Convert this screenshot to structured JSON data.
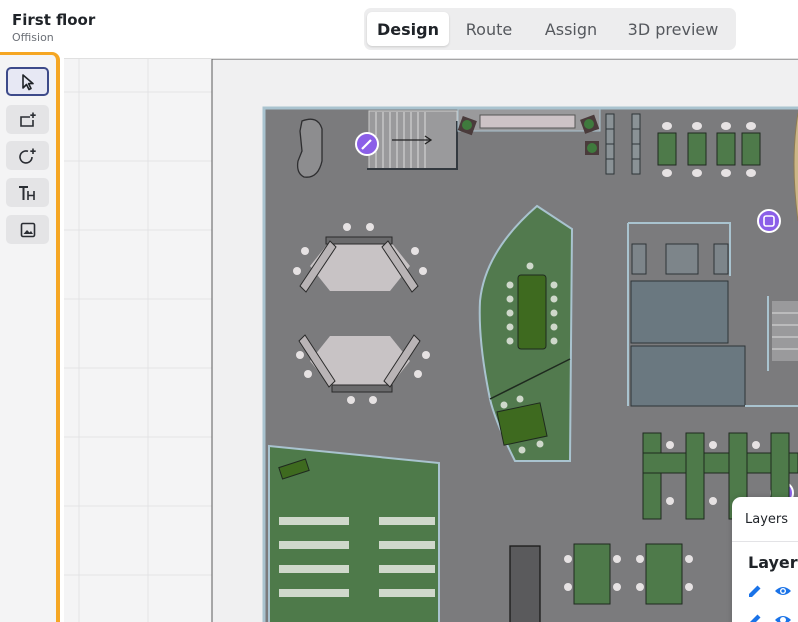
{
  "header": {
    "title": "First floor",
    "subtitle": "Offision"
  },
  "tabs": [
    {
      "label": "Design",
      "active": true
    },
    {
      "label": "Route",
      "active": false
    },
    {
      "label": "Assign",
      "active": false
    },
    {
      "label": "3D preview",
      "active": false
    }
  ],
  "toolbar": {
    "tools": [
      {
        "icon": "cursor-icon",
        "active": true
      },
      {
        "icon": "add-rectangle-icon",
        "active": false
      },
      {
        "icon": "add-circle-icon",
        "active": false
      },
      {
        "icon": "text-tool-icon",
        "active": false
      },
      {
        "icon": "image-icon",
        "active": false
      }
    ]
  },
  "layers": {
    "tab_label": "Layers",
    "heading": "Layers"
  },
  "colors": {
    "accent": "#3d4a8a",
    "highlight": "#f5a623",
    "room_green": "#4e7a4a",
    "floor": "#7b7b7d",
    "marker_purple": "#8b5fe8"
  }
}
